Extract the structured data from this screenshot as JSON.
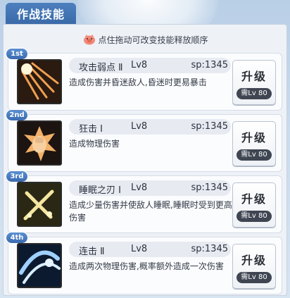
{
  "title": "作战技能",
  "hint": "点住拖动可改变技能释放顺序",
  "skills": [
    {
      "rank": "1st",
      "name": "攻击弱点 Ⅱ",
      "level": "Lv8",
      "sp": "sp:1345",
      "desc": "造成伤害并昏迷敌人,昏迷时更易暴击",
      "upgrade": "升级",
      "req": "需Lv 80",
      "icon": "weak-point-strike-icon"
    },
    {
      "rank": "2nd",
      "name": "狂击 Ⅰ",
      "level": "Lv8",
      "sp": "sp:1345",
      "desc": "造成物理伤害",
      "upgrade": "升级",
      "req": "需Lv 80",
      "icon": "frenzy-strike-icon"
    },
    {
      "rank": "3rd",
      "name": "睡眠之刃 Ⅰ",
      "level": "Lv8",
      "sp": "sp:1345",
      "desc": "造成少量伤害并使敌人睡眠,睡眠时受到更高伤害",
      "upgrade": "升级",
      "req": "需Lv 80",
      "icon": "sleep-blade-icon"
    },
    {
      "rank": "4th",
      "name": "连击 Ⅱ",
      "level": "Lv8",
      "sp": "sp:1345",
      "desc": "造成两次物理伤害,概率额外造成一次伤害",
      "upgrade": "升级",
      "req": "需Lv 80",
      "icon": "combo-strike-icon"
    }
  ]
}
